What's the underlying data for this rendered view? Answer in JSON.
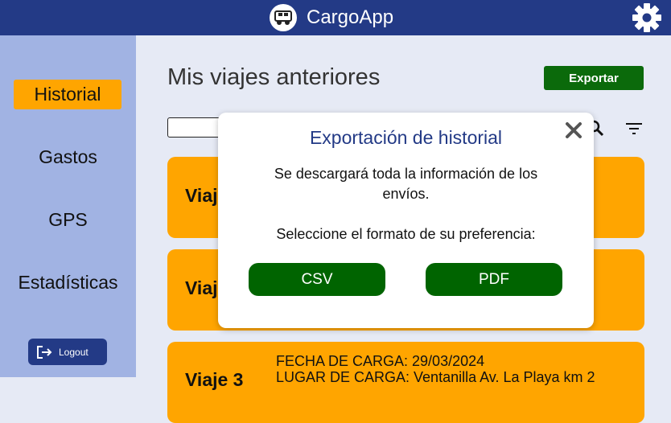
{
  "app": {
    "title": "CargoApp"
  },
  "sidebar": {
    "items": [
      {
        "label": "Historial",
        "active": true
      },
      {
        "label": "Gastos"
      },
      {
        "label": "GPS"
      },
      {
        "label": "Estadísticas"
      }
    ],
    "logout_label": "Logout"
  },
  "page": {
    "title": "Mis viajes anteriores",
    "export_label": "Exportar",
    "search_value": ""
  },
  "cards": [
    {
      "title": "Viaj"
    },
    {
      "title": "Viaj"
    },
    {
      "title": "Viaje 3",
      "fecha": "FECHA DE CARGA: 29/03/2024",
      "lugar": "LUGAR DE CARGA: Ventanilla Av. La Playa km 2"
    }
  ],
  "modal": {
    "title": "Exportación de historial",
    "line1": "Se descargará toda la información de los",
    "line2": "envíos.",
    "line3": "Seleccione el formato de su preferencia:",
    "csv_label": "CSV",
    "pdf_label": "PDF"
  },
  "colors": {
    "header": "#233a86",
    "sidebar": "#a1b3e3",
    "accent": "#ffa500",
    "green": "#0b6a0b"
  }
}
